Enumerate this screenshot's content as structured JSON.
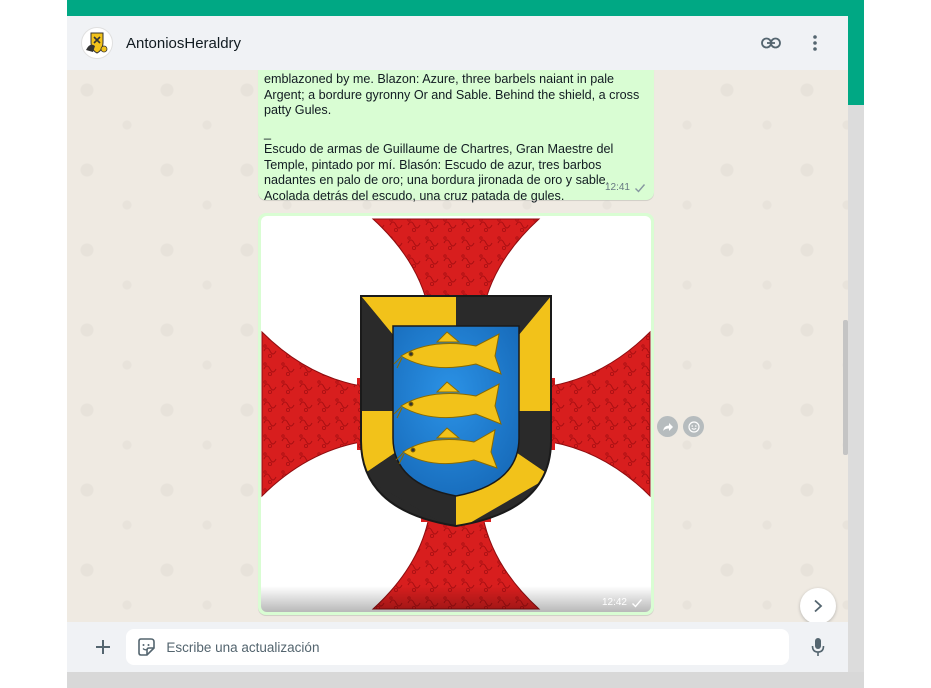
{
  "colors": {
    "accent": "#00a884",
    "header_bg": "#f0f2f5",
    "chat_bg": "#efeae2",
    "outgoing_bubble": "#d9fdd3",
    "azure": "#1e7fd4",
    "gules": "#d81e1e",
    "or": "#f2c21a",
    "sable": "#2a2a2a"
  },
  "header": {
    "title": "AntoniosHeraldry",
    "avatar_icon": "heraldry-avatar-icon",
    "actions": [
      "link-icon",
      "more-vertical-icon"
    ]
  },
  "messages": [
    {
      "type": "text",
      "paragraph_en": "emblazoned by me. Blazon: Azure, three barbels naiant in pale Argent; a bordure gyronny Or and Sable. Behind the shield, a cross patty Gules.",
      "separator": "_",
      "paragraph_es": "Escudo de armas de Guillaume de Chartres, Gran Maestre del Temple, pintado por mí. Blasón: Escudo de azur, tres barbos nadantes en palo de oro; una bordura jironada de oro y sable. Acolada detrás del escudo, una cruz patada de gules.",
      "time": "12:41",
      "status_icon": "single-check-icon"
    },
    {
      "type": "image",
      "time": "12:42",
      "status_icon": "single-check-icon"
    }
  ],
  "message_actions": [
    "forward-icon",
    "emoji-reaction-icon"
  ],
  "composer": {
    "placeholder": "Escribe una actualización",
    "attach_icon": "plus-icon",
    "sticker_icon": "sticker-icon",
    "mic_icon": "microphone-icon"
  },
  "scroll_down_icon": "chevron-right-icon"
}
